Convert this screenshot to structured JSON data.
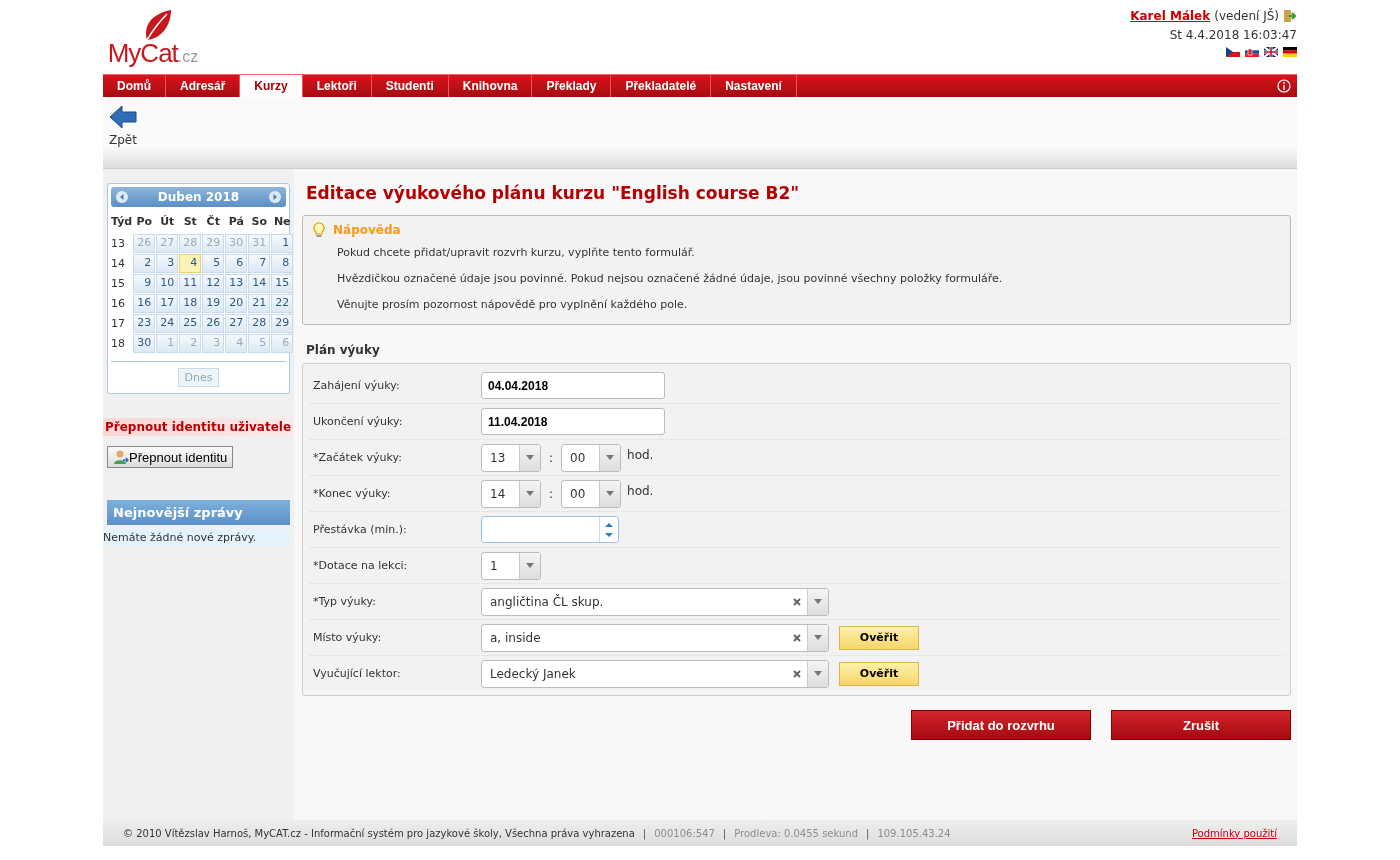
{
  "header": {
    "logo": {
      "brand": "MyCat",
      "domain": ".cz"
    },
    "user": {
      "name": "Karel Málek",
      "role": "(vedení JŠ)",
      "datetime": "St 4.4.2018 16:03:47"
    }
  },
  "nav": {
    "items": [
      {
        "label": "Domů",
        "selected": false
      },
      {
        "label": "Adresář",
        "selected": false
      },
      {
        "label": "Kurzy",
        "selected": true
      },
      {
        "label": "Lektoři",
        "selected": false
      },
      {
        "label": "Studenti",
        "selected": false
      },
      {
        "label": "Knihovna",
        "selected": false
      },
      {
        "label": "Překlady",
        "selected": false
      },
      {
        "label": "Překladatelé",
        "selected": false
      },
      {
        "label": "Nastavení",
        "selected": false
      }
    ]
  },
  "toolbar": {
    "back_label": "Zpět"
  },
  "calendar": {
    "title": "Duben 2018",
    "headers": [
      "Týd",
      "Po",
      "Út",
      "St",
      "Čt",
      "Pá",
      "So",
      "Ne"
    ],
    "weeks": [
      {
        "week": "13",
        "days": [
          {
            "d": "26",
            "outside": true,
            "today": false
          },
          {
            "d": "27",
            "outside": true,
            "today": false
          },
          {
            "d": "28",
            "outside": true,
            "today": false
          },
          {
            "d": "29",
            "outside": true,
            "today": false
          },
          {
            "d": "30",
            "outside": true,
            "today": false
          },
          {
            "d": "31",
            "outside": true,
            "today": false
          },
          {
            "d": "1",
            "outside": false,
            "today": false
          }
        ]
      },
      {
        "week": "14",
        "days": [
          {
            "d": "2",
            "outside": false,
            "today": false
          },
          {
            "d": "3",
            "outside": false,
            "today": false
          },
          {
            "d": "4",
            "outside": false,
            "today": true
          },
          {
            "d": "5",
            "outside": false,
            "today": false
          },
          {
            "d": "6",
            "outside": false,
            "today": false
          },
          {
            "d": "7",
            "outside": false,
            "today": false
          },
          {
            "d": "8",
            "outside": false,
            "today": false
          }
        ]
      },
      {
        "week": "15",
        "days": [
          {
            "d": "9",
            "outside": false,
            "today": false
          },
          {
            "d": "10",
            "outside": false,
            "today": false
          },
          {
            "d": "11",
            "outside": false,
            "today": false
          },
          {
            "d": "12",
            "outside": false,
            "today": false
          },
          {
            "d": "13",
            "outside": false,
            "today": false
          },
          {
            "d": "14",
            "outside": false,
            "today": false
          },
          {
            "d": "15",
            "outside": false,
            "today": false
          }
        ]
      },
      {
        "week": "16",
        "days": [
          {
            "d": "16",
            "outside": false,
            "today": false
          },
          {
            "d": "17",
            "outside": false,
            "today": false
          },
          {
            "d": "18",
            "outside": false,
            "today": false
          },
          {
            "d": "19",
            "outside": false,
            "today": false
          },
          {
            "d": "20",
            "outside": false,
            "today": false
          },
          {
            "d": "21",
            "outside": false,
            "today": false
          },
          {
            "d": "22",
            "outside": false,
            "today": false
          }
        ]
      },
      {
        "week": "17",
        "days": [
          {
            "d": "23",
            "outside": false,
            "today": false
          },
          {
            "d": "24",
            "outside": false,
            "today": false
          },
          {
            "d": "25",
            "outside": false,
            "today": false
          },
          {
            "d": "26",
            "outside": false,
            "today": false
          },
          {
            "d": "27",
            "outside": false,
            "today": false
          },
          {
            "d": "28",
            "outside": false,
            "today": false
          },
          {
            "d": "29",
            "outside": false,
            "today": false
          }
        ]
      },
      {
        "week": "18",
        "days": [
          {
            "d": "30",
            "outside": false,
            "today": false
          },
          {
            "d": "1",
            "outside": true,
            "today": false
          },
          {
            "d": "2",
            "outside": true,
            "today": false
          },
          {
            "d": "3",
            "outside": true,
            "today": false
          },
          {
            "d": "4",
            "outside": true,
            "today": false
          },
          {
            "d": "5",
            "outside": true,
            "today": false
          },
          {
            "d": "6",
            "outside": true,
            "today": false
          }
        ]
      }
    ],
    "today_button": "Dnes"
  },
  "identity": {
    "title": "Přepnout identitu uživatele",
    "button": "Přepnout identitu"
  },
  "news": {
    "title": "Nejnovější zprávy",
    "empty": "Nemáte žádné nové zprávy."
  },
  "main": {
    "title": "Editace výukového plánu kurzu \"English course B2\"",
    "help": {
      "title": "Nápověda",
      "lines": [
        "Pokud chcete přidat/upravit rozvrh kurzu, vyplňte tento formulář.",
        "Hvězdičkou označené údaje jsou povinné. Pokud nejsou označené žádné údaje, jsou povinné všechny položky formuláře.",
        "Věnujte prosím pozornost nápovědě pro vyplnění každého pole."
      ]
    },
    "section_title": "Plán výuky",
    "rows": [
      {
        "kind": "text",
        "label": "Zahájení výuky:",
        "value": "04.04.2018"
      },
      {
        "kind": "text",
        "label": "Ukončení výuky:",
        "value": "11.04.2018"
      },
      {
        "kind": "time",
        "label": "*Začátek výuky:",
        "hour": "13",
        "separator": ":",
        "minute": "00",
        "unit": "hod."
      },
      {
        "kind": "time",
        "label": "*Konec výuky:",
        "hour": "14",
        "separator": ":",
        "minute": "00",
        "unit": "hod."
      },
      {
        "kind": "number",
        "label": "Přestávka (min.):"
      },
      {
        "kind": "select",
        "label": "*Dotace na lekci:",
        "value": "1"
      },
      {
        "kind": "combo",
        "label": "*Typ výuky:",
        "value": "angličtina ČL skup."
      },
      {
        "kind": "combo",
        "label": "Místo výuky:",
        "value": "a, inside",
        "button": "Ověřit"
      },
      {
        "kind": "combo",
        "label": "Vyučující lektor:",
        "value": "Ledecký Janek",
        "button": "Ověřit"
      }
    ],
    "buttons": [
      "Přidat do rozvrhu",
      "Zrušit"
    ]
  },
  "footer": {
    "copyright": "© 2010 Vítězslav Harnoš, MyCAT.cz - Informační systém pro jazykové školy, Všechna práva vyhrazena",
    "separator": "|",
    "stats": [
      "000106:547",
      "Prodleva: 0.0455 sekund",
      "109.105.43.24"
    ],
    "terms": "Podmínky použití"
  }
}
